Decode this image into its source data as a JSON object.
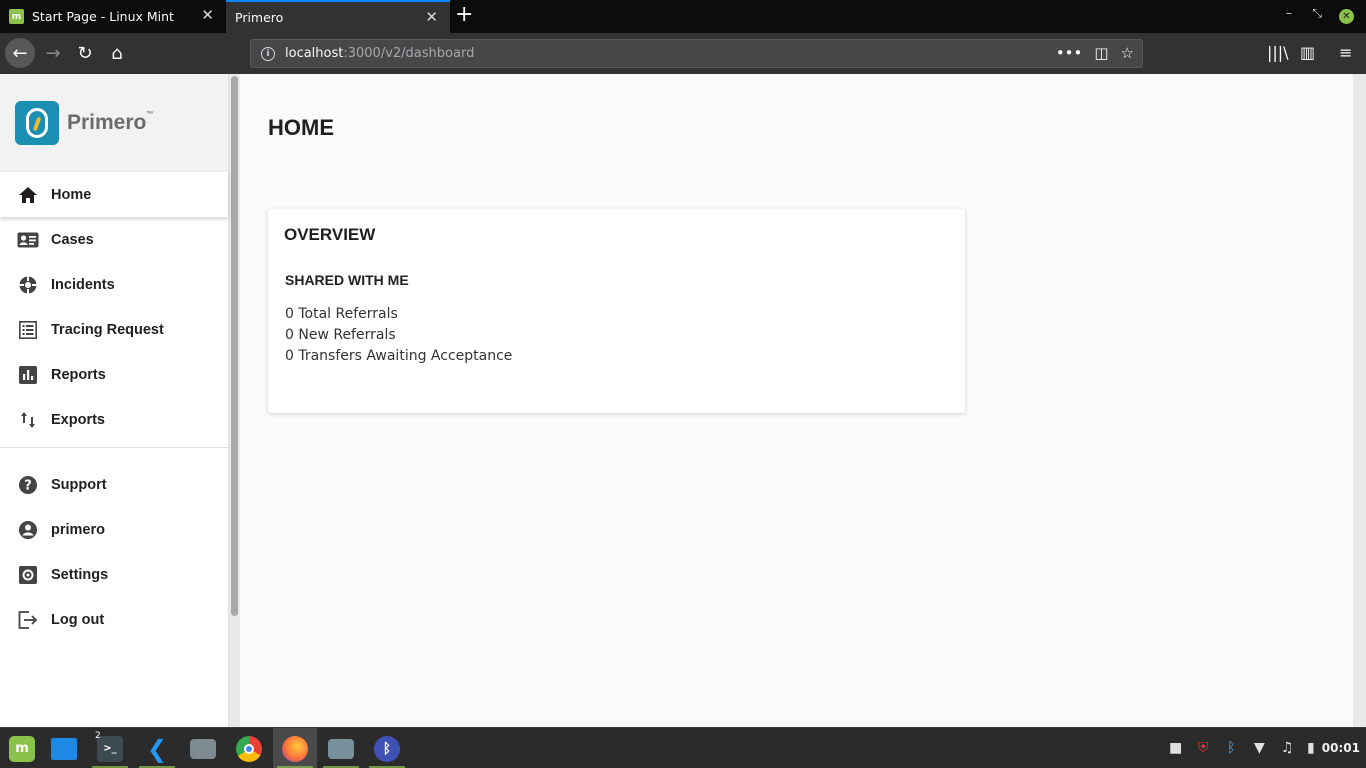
{
  "browser": {
    "tabs": [
      {
        "label": "Start Page - Linux Mint",
        "active": false
      },
      {
        "label": "Primero",
        "active": true
      }
    ],
    "url_host": "localhost",
    "url_rest": ":3000/v2/dashboard"
  },
  "brand": {
    "name": "Primero",
    "trademark": "™"
  },
  "sidebar": {
    "items": [
      {
        "label": "Home",
        "icon": "home-icon"
      },
      {
        "label": "Cases",
        "icon": "id-card-icon"
      },
      {
        "label": "Incidents",
        "icon": "incident-icon"
      },
      {
        "label": "Tracing Request",
        "icon": "list-icon"
      },
      {
        "label": "Reports",
        "icon": "bar-chart-icon"
      },
      {
        "label": "Exports",
        "icon": "swap-vertical-icon"
      }
    ],
    "secondary": [
      {
        "label": "Support",
        "icon": "help-icon"
      },
      {
        "label": "primero",
        "icon": "account-icon"
      },
      {
        "label": "Settings",
        "icon": "gear-icon"
      },
      {
        "label": "Log out",
        "icon": "logout-icon"
      }
    ]
  },
  "main": {
    "title": "HOME",
    "overview": {
      "title": "OVERVIEW",
      "section": "SHARED WITH ME",
      "stats": [
        "0 Total Referrals",
        "0 New Referrals",
        "0 Transfers Awaiting Acceptance"
      ]
    }
  },
  "taskbar": {
    "workspace_badge": "2",
    "clock": "00:01"
  },
  "colors": {
    "accent": "#0a84ff",
    "brand_teal": "#1a8fb1",
    "mint_green": "#8bc34a"
  }
}
